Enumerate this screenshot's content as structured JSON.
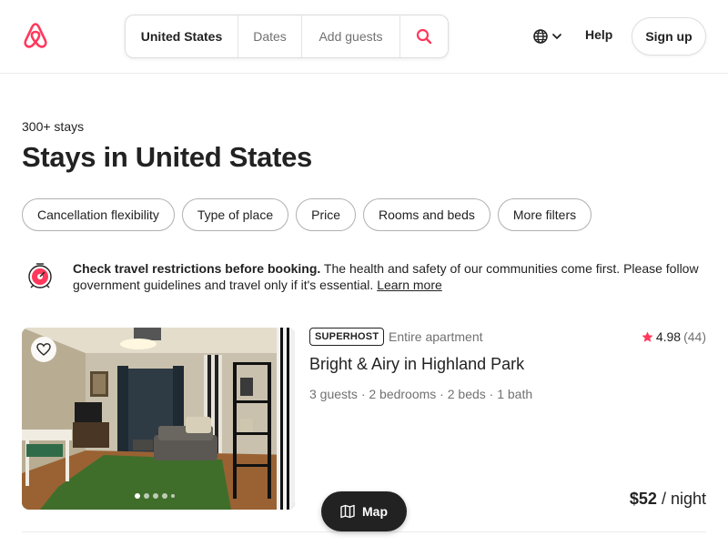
{
  "header": {
    "search": {
      "location": "United States",
      "dates": "Dates",
      "guests": "Add guests"
    },
    "help": "Help",
    "signup": "Sign up"
  },
  "main": {
    "count": "300+ stays",
    "title": "Stays in United States",
    "filters": [
      "Cancellation flexibility",
      "Type of place",
      "Price",
      "Rooms and beds",
      "More filters"
    ],
    "notice": {
      "bold": "Check travel restrictions before booking.",
      "text": " The health and safety of our communities come first. Please follow government guidelines and travel only if it's essential. ",
      "link": "Learn more"
    }
  },
  "listing": {
    "badge": "SUPERHOST",
    "type": "Entire apartment",
    "rating": "4.98",
    "reviews": "(44)",
    "name": "Bright & Airy in Highland Park",
    "details": "3 guests · 2 bedrooms · 2 beds · 1 bath",
    "price": "$52",
    "price_unit": " / night",
    "photo_dots": 5,
    "photo_active": 0
  },
  "map_button": "Map",
  "colors": {
    "brand": "#FF385C",
    "text": "#222222",
    "muted": "#717171"
  },
  "icons": [
    "airbnb-logo",
    "search-icon",
    "globe-icon",
    "chevron-down-icon",
    "alert-icon",
    "heart-icon",
    "star-icon",
    "map-icon"
  ]
}
